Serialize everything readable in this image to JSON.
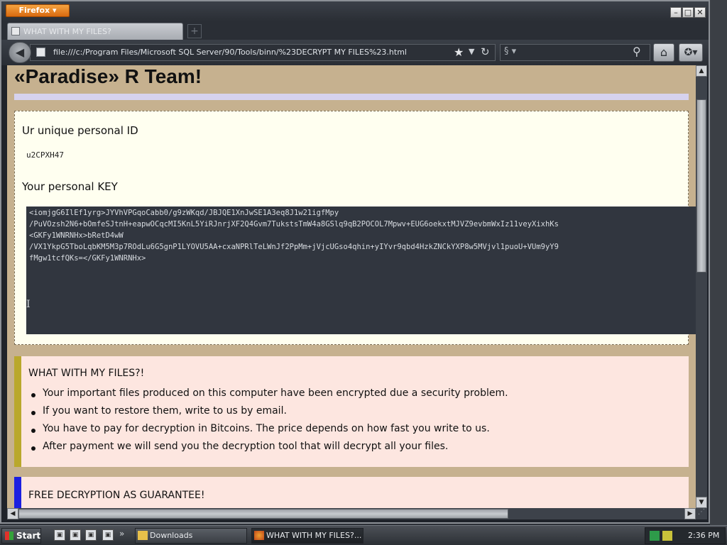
{
  "browser": {
    "app_menu_label": "Firefox",
    "window_controls": {
      "minimize": "–",
      "maximize": "□",
      "close": "✕"
    },
    "tab": {
      "title": "WHAT WITH MY FILES?"
    },
    "new_tab_symbol": "+",
    "url": "file:///c:/Program Files/Microsoft SQL Server/90/Tools/binn/%23DECRYPT MY FILES%23.html",
    "icons": [
      "back-arrow-icon",
      "page-icon",
      "bookmark-star-icon",
      "dropdown-icon",
      "reload-icon",
      "search-engine-icon",
      "search-magnifier-icon",
      "home-icon",
      "bookmarks-icon"
    ]
  },
  "page": {
    "title": "«Paradise» R Team!",
    "id_section": {
      "heading": "Ur unique personal ID",
      "value": "u2CPXH47"
    },
    "key_section": {
      "heading": "Your personal KEY",
      "lines": [
        "<iomjgG6IlEf1yrg>JYVhVPGqoCabb0/g9zWKqd/JBJQE1XnJwSE1A3eq8J1w21igfMpy",
        "/PuVOzsh2N6+bOmfeSJtnH+eapwOCqcMI5KnL5YiRJnrjXF2Q4Gvm7TukstsTmW4a8GSlq9qB2POCOL7Mpwv+EUG6oekxtMJVZ9evbmWxIz11veyXixhKs",
        "<GKFy1WNRNHx>bRetD4wW",
        "/VX1YkpG5TboLqbKM5M3p7ROdLu6G5gnP1LYOVU5AA+cxaNPRlTeLWnJf2PpMm+jVjcUGso4qhin+yIYvr9qbd4HzkZNCkYXP8w5MVjvl1puoU+VUm9yY9",
        "fMgw1tcfQKs=</GKFy1WNRNHx>"
      ]
    },
    "files_section": {
      "heading": "WHAT WITH MY FILES?!",
      "items": [
        "Your important files produced on this computer have been encrypted due a security problem.",
        "If you want to restore them, write to us by email.",
        "You have to pay for decryption in Bitcoins. The price depends on how fast you write to us.",
        "After payment we will send you the decryption tool that will decrypt all your files."
      ],
      "accent_color": "#b9a82c"
    },
    "guarantee_section": {
      "heading": "FREE DECRYPTION AS GUARANTEE!",
      "accent_color": "#1b1fe0"
    }
  },
  "taskbar": {
    "start_label": "Start",
    "quick_launch_more": "»",
    "tasks": [
      {
        "label": "Downloads",
        "icon": "folder-icon"
      },
      {
        "label": "WHAT WITH MY FILES?...",
        "icon": "firefox-icon"
      }
    ],
    "clock": "2:36 PM"
  },
  "colors": {
    "page_background": "#c6b18f",
    "key_box_background": "#31363f",
    "notice_background": "#fde6e0"
  }
}
